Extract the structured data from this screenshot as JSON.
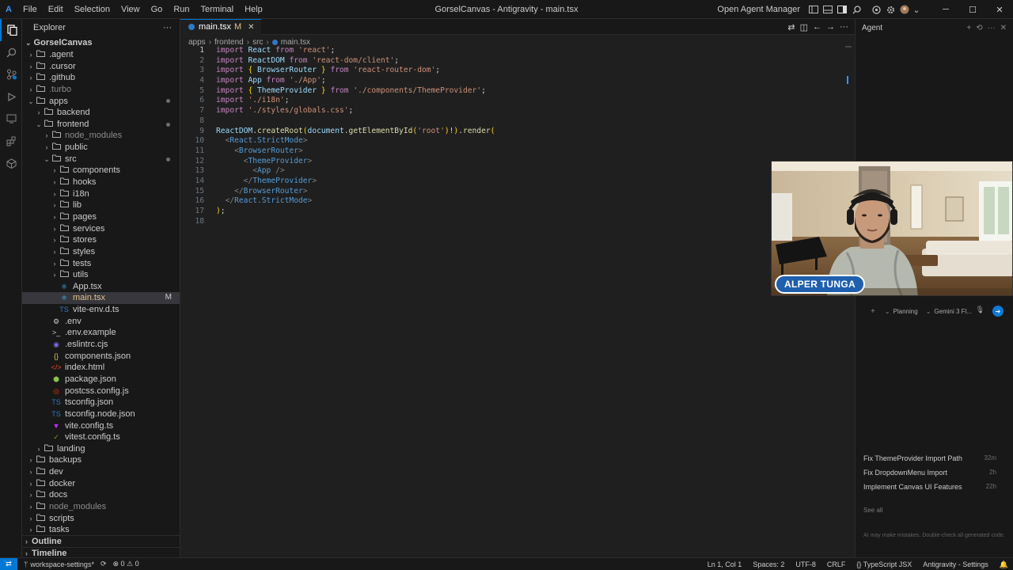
{
  "titlebar": {
    "logo": "A",
    "menu": [
      "File",
      "Edit",
      "Selection",
      "View",
      "Go",
      "Run",
      "Terminal",
      "Help"
    ],
    "title": "GorselCanvas - Antigravity - main.tsx",
    "agent_manager": "Open Agent Manager"
  },
  "explorer": {
    "title": "Explorer",
    "more": "···",
    "root": "GorselCanvas",
    "items": [
      {
        "label": ".agent",
        "depth": 1,
        "kind": "folder",
        "open": false
      },
      {
        "label": ".cursor",
        "depth": 1,
        "kind": "folder",
        "open": false
      },
      {
        "label": ".github",
        "depth": 1,
        "kind": "folder",
        "open": false
      },
      {
        "label": ".turbo",
        "depth": 1,
        "kind": "folder",
        "open": false,
        "dim": true
      },
      {
        "label": "apps",
        "depth": 1,
        "kind": "folder",
        "open": true,
        "dot": true
      },
      {
        "label": "backend",
        "depth": 2,
        "kind": "folder",
        "open": false
      },
      {
        "label": "frontend",
        "depth": 2,
        "kind": "folder",
        "open": true,
        "dot": true
      },
      {
        "label": "node_modules",
        "depth": 3,
        "kind": "folder",
        "open": false,
        "dim": true
      },
      {
        "label": "public",
        "depth": 3,
        "kind": "folder",
        "open": false
      },
      {
        "label": "src",
        "depth": 3,
        "kind": "folder",
        "open": true,
        "dot": true
      },
      {
        "label": "components",
        "depth": 4,
        "kind": "folder",
        "open": false
      },
      {
        "label": "hooks",
        "depth": 4,
        "kind": "folder",
        "open": false
      },
      {
        "label": "i18n",
        "depth": 4,
        "kind": "folder",
        "open": false
      },
      {
        "label": "lib",
        "depth": 4,
        "kind": "folder",
        "open": false
      },
      {
        "label": "pages",
        "depth": 4,
        "kind": "folder",
        "open": false
      },
      {
        "label": "services",
        "depth": 4,
        "kind": "folder",
        "open": false
      },
      {
        "label": "stores",
        "depth": 4,
        "kind": "folder",
        "open": false
      },
      {
        "label": "styles",
        "depth": 4,
        "kind": "folder",
        "open": false
      },
      {
        "label": "tests",
        "depth": 4,
        "kind": "folder",
        "open": false
      },
      {
        "label": "utils",
        "depth": 4,
        "kind": "folder",
        "open": false
      },
      {
        "label": "App.tsx",
        "depth": 4,
        "kind": "tsx"
      },
      {
        "label": "main.tsx",
        "depth": 4,
        "kind": "tsx",
        "selected": true,
        "badge": "M"
      },
      {
        "label": "vite-env.d.ts",
        "depth": 4,
        "kind": "ts"
      },
      {
        "label": ".env",
        "depth": 3,
        "kind": "gear"
      },
      {
        "label": ".env.example",
        "depth": 3,
        "kind": "prompt"
      },
      {
        "label": ".eslintrc.cjs",
        "depth": 3,
        "kind": "eslint"
      },
      {
        "label": "components.json",
        "depth": 3,
        "kind": "json"
      },
      {
        "label": "index.html",
        "depth": 3,
        "kind": "html"
      },
      {
        "label": "package.json",
        "depth": 3,
        "kind": "npm"
      },
      {
        "label": "postcss.config.js",
        "depth": 3,
        "kind": "postcss"
      },
      {
        "label": "tsconfig.json",
        "depth": 3,
        "kind": "tsconfig"
      },
      {
        "label": "tsconfig.node.json",
        "depth": 3,
        "kind": "tsconfig"
      },
      {
        "label": "vite.config.ts",
        "depth": 3,
        "kind": "vite"
      },
      {
        "label": "vitest.config.ts",
        "depth": 3,
        "kind": "vitest"
      },
      {
        "label": "landing",
        "depth": 2,
        "kind": "folder",
        "open": false
      },
      {
        "label": "backups",
        "depth": 1,
        "kind": "folder",
        "open": false
      },
      {
        "label": "dev",
        "depth": 1,
        "kind": "folder",
        "open": false
      },
      {
        "label": "docker",
        "depth": 1,
        "kind": "folder",
        "open": false
      },
      {
        "label": "docs",
        "depth": 1,
        "kind": "folder",
        "open": false
      },
      {
        "label": "node_modules",
        "depth": 1,
        "kind": "folder",
        "open": false,
        "dim": true
      },
      {
        "label": "scripts",
        "depth": 1,
        "kind": "folder",
        "open": false
      },
      {
        "label": "tasks",
        "depth": 1,
        "kind": "folder",
        "open": false
      }
    ],
    "outline": "Outline",
    "timeline": "Timeline"
  },
  "editor": {
    "tab": {
      "label": "main.tsx",
      "badge": "M",
      "close": "✕"
    },
    "breadcrumb": [
      "apps",
      "frontend",
      "src",
      "main.tsx"
    ],
    "lines": [
      "<span class=\"kw\">import</span> <span class=\"idn\">React</span> <span class=\"kw\">from</span> <span class=\"str\">'react'</span>;",
      "<span class=\"kw\">import</span> <span class=\"idn\">ReactDOM</span> <span class=\"kw\">from</span> <span class=\"str\">'react-dom/client'</span>;",
      "<span class=\"kw\">import</span> <span class=\"brace\">{</span> <span class=\"idn\">BrowserRouter</span> <span class=\"brace\">}</span> <span class=\"kw\">from</span> <span class=\"str\">'react-router-dom'</span>;",
      "<span class=\"kw\">import</span> <span class=\"idn\">App</span> <span class=\"kw\">from</span> <span class=\"str\">'./App'</span>;",
      "<span class=\"kw\">import</span> <span class=\"brace\">{</span> <span class=\"idn\">ThemeProvider</span> <span class=\"brace\">}</span> <span class=\"kw\">from</span> <span class=\"str\">'./components/ThemeProvider'</span>;",
      "<span class=\"kw\">import</span> <span class=\"str\">'./i18n'</span>;",
      "<span class=\"kw\">import</span> <span class=\"str\">'./styles/globals.css'</span>;",
      "",
      "<span class=\"idn\">ReactDOM</span>.<span class=\"fn\">createRoot</span><span class=\"brace\">(</span><span class=\"idn\">document</span>.<span class=\"fn\">getElementById</span><span class=\"brace\">(</span><span class=\"str\">'root'</span><span class=\"brace\">)</span>!<span class=\"brace\">)</span>.<span class=\"fn\">render</span><span class=\"brace\">(</span>",
      "  <span class=\"gt\">&lt;</span><span class=\"tag\">React.StrictMode</span><span class=\"gt\">&gt;</span>",
      "    <span class=\"gt\">&lt;</span><span class=\"tag\">BrowserRouter</span><span class=\"gt\">&gt;</span>",
      "      <span class=\"gt\">&lt;</span><span class=\"tag\">ThemeProvider</span><span class=\"gt\">&gt;</span>",
      "        <span class=\"gt\">&lt;</span><span class=\"tag\">App</span> <span class=\"gt\">/&gt;</span>",
      "      <span class=\"gt\">&lt;/</span><span class=\"tag\">ThemeProvider</span><span class=\"gt\">&gt;</span>",
      "    <span class=\"gt\">&lt;/</span><span class=\"tag\">BrowserRouter</span><span class=\"gt\">&gt;</span>",
      "  <span class=\"gt\">&lt;/</span><span class=\"tag\">React.StrictMode</span><span class=\"gt\">&gt;</span>",
      "<span class=\"brace\">)</span>;",
      ""
    ],
    "current_line": 1
  },
  "agent": {
    "title": "Agent",
    "webcam_name": "ALPER TUNGA",
    "input": {
      "plus": "+",
      "mode": "Planning",
      "model": "Gemini 3 Fl..."
    },
    "conversations": [
      {
        "title": "Fix ThemeProvider Import Path",
        "age": "32m"
      },
      {
        "title": "Fix DropdownMenu Import",
        "age": "2h"
      },
      {
        "title": "Implement Canvas UI Features",
        "age": "22h"
      }
    ],
    "see_all": "See all",
    "disclaimer": "AI may make mistakes. Double-check all generated code."
  },
  "statusbar": {
    "remote": "⇄",
    "branch": "workspace-settings*",
    "sync": "⟳",
    "problems": "⊗ 0 ⚠ 0",
    "right": [
      "Ln 1, Col 1",
      "Spaces: 2",
      "UTF-8",
      "CRLF",
      "{} TypeScript JSX",
      "Antigravity - Settings",
      "🔔"
    ]
  },
  "colors": {
    "accent": "#0078d4",
    "bg": "#1f1f1f",
    "sidebar": "#181818"
  }
}
